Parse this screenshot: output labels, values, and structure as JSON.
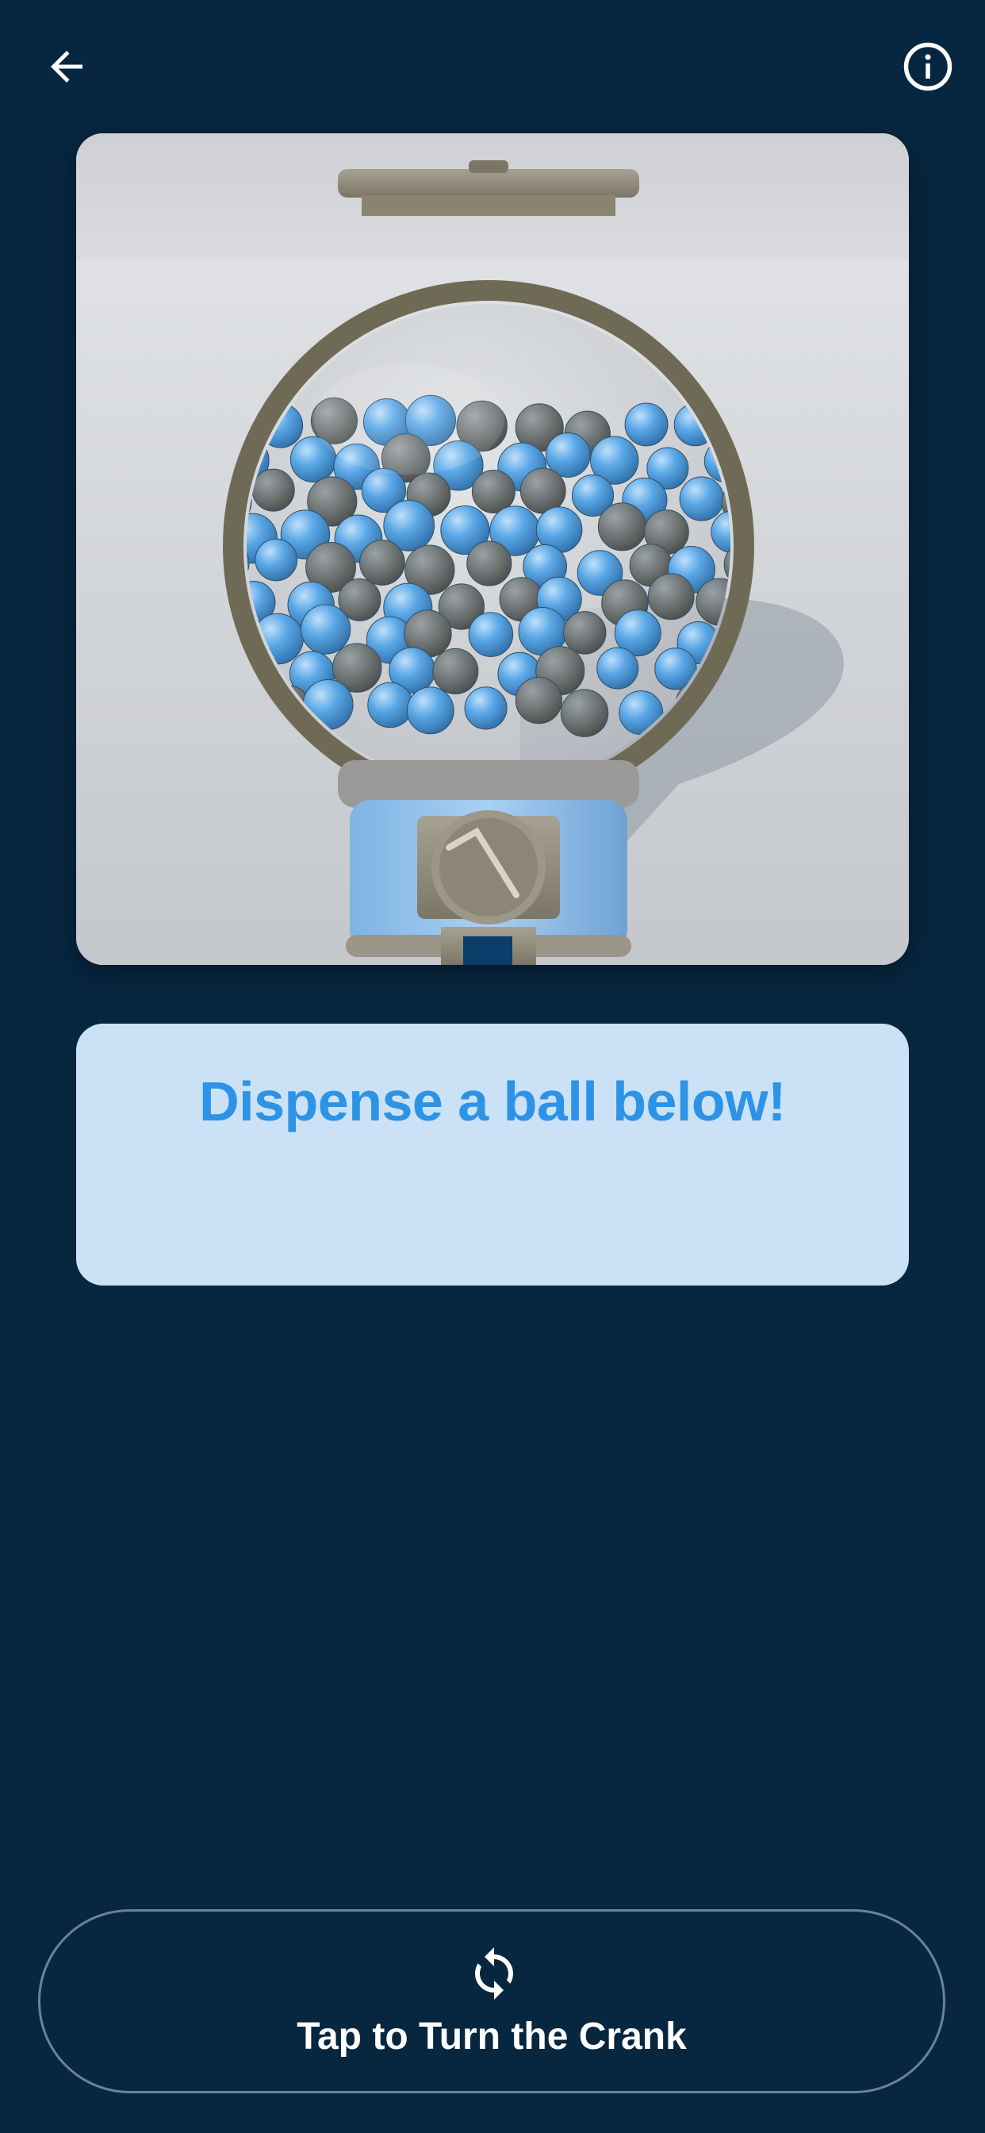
{
  "header": {
    "back_icon": "arrow-left-icon",
    "info_icon": "info-circle-icon"
  },
  "image": {
    "description_icon": "gumball-machine-image",
    "ball_color": "#5aa7e6"
  },
  "message": {
    "text": "Dispense a ball below!"
  },
  "crank_button": {
    "icon": "refresh-icon",
    "label": "Tap to Turn the Crank"
  },
  "colors": {
    "background": "#07263f",
    "accent": "#2c93e6",
    "card": "#cbe1f6"
  }
}
